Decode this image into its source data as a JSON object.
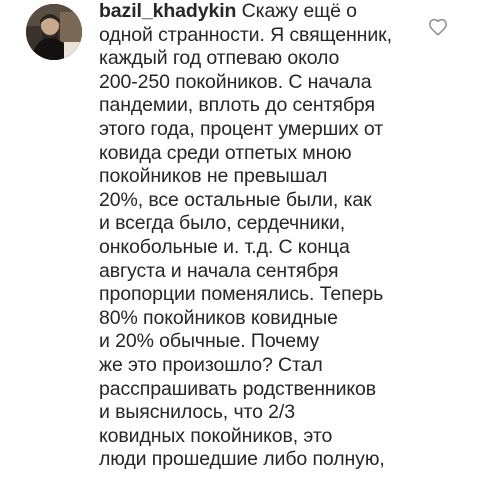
{
  "comment": {
    "username": "bazil_khadykin",
    "first_line_text": "Скажу ещё о",
    "lines": [
      "одной странности. Я священник,",
      "каждый год отпеваю  около",
      "200-250 покойников. С начала",
      "пандемии, вплоть до сентября",
      "этого года, процент умерших от",
      "ковида среди отпетых мною",
      "покойников не превышал",
      "20%, все остальные были, как",
      "и всегда было, сердечники,",
      "онкобольные и. т.д. С конца",
      "августа и начала сентября",
      "пропорции поменялись. Теперь",
      "80% покойников ковидные",
      "и 20% обычные. Почему",
      "же это произошло? Стал",
      "расспрашивать родственников",
      "и выяснилось, что 2/3",
      "ковидных покойников, это",
      "люди прошедшие либо полную,"
    ]
  },
  "icons": {
    "like": "heart-outline-icon",
    "avatar": "user-avatar"
  },
  "colors": {
    "text": "#262626",
    "icon": "#8e8e8e",
    "background": "#ffffff"
  }
}
